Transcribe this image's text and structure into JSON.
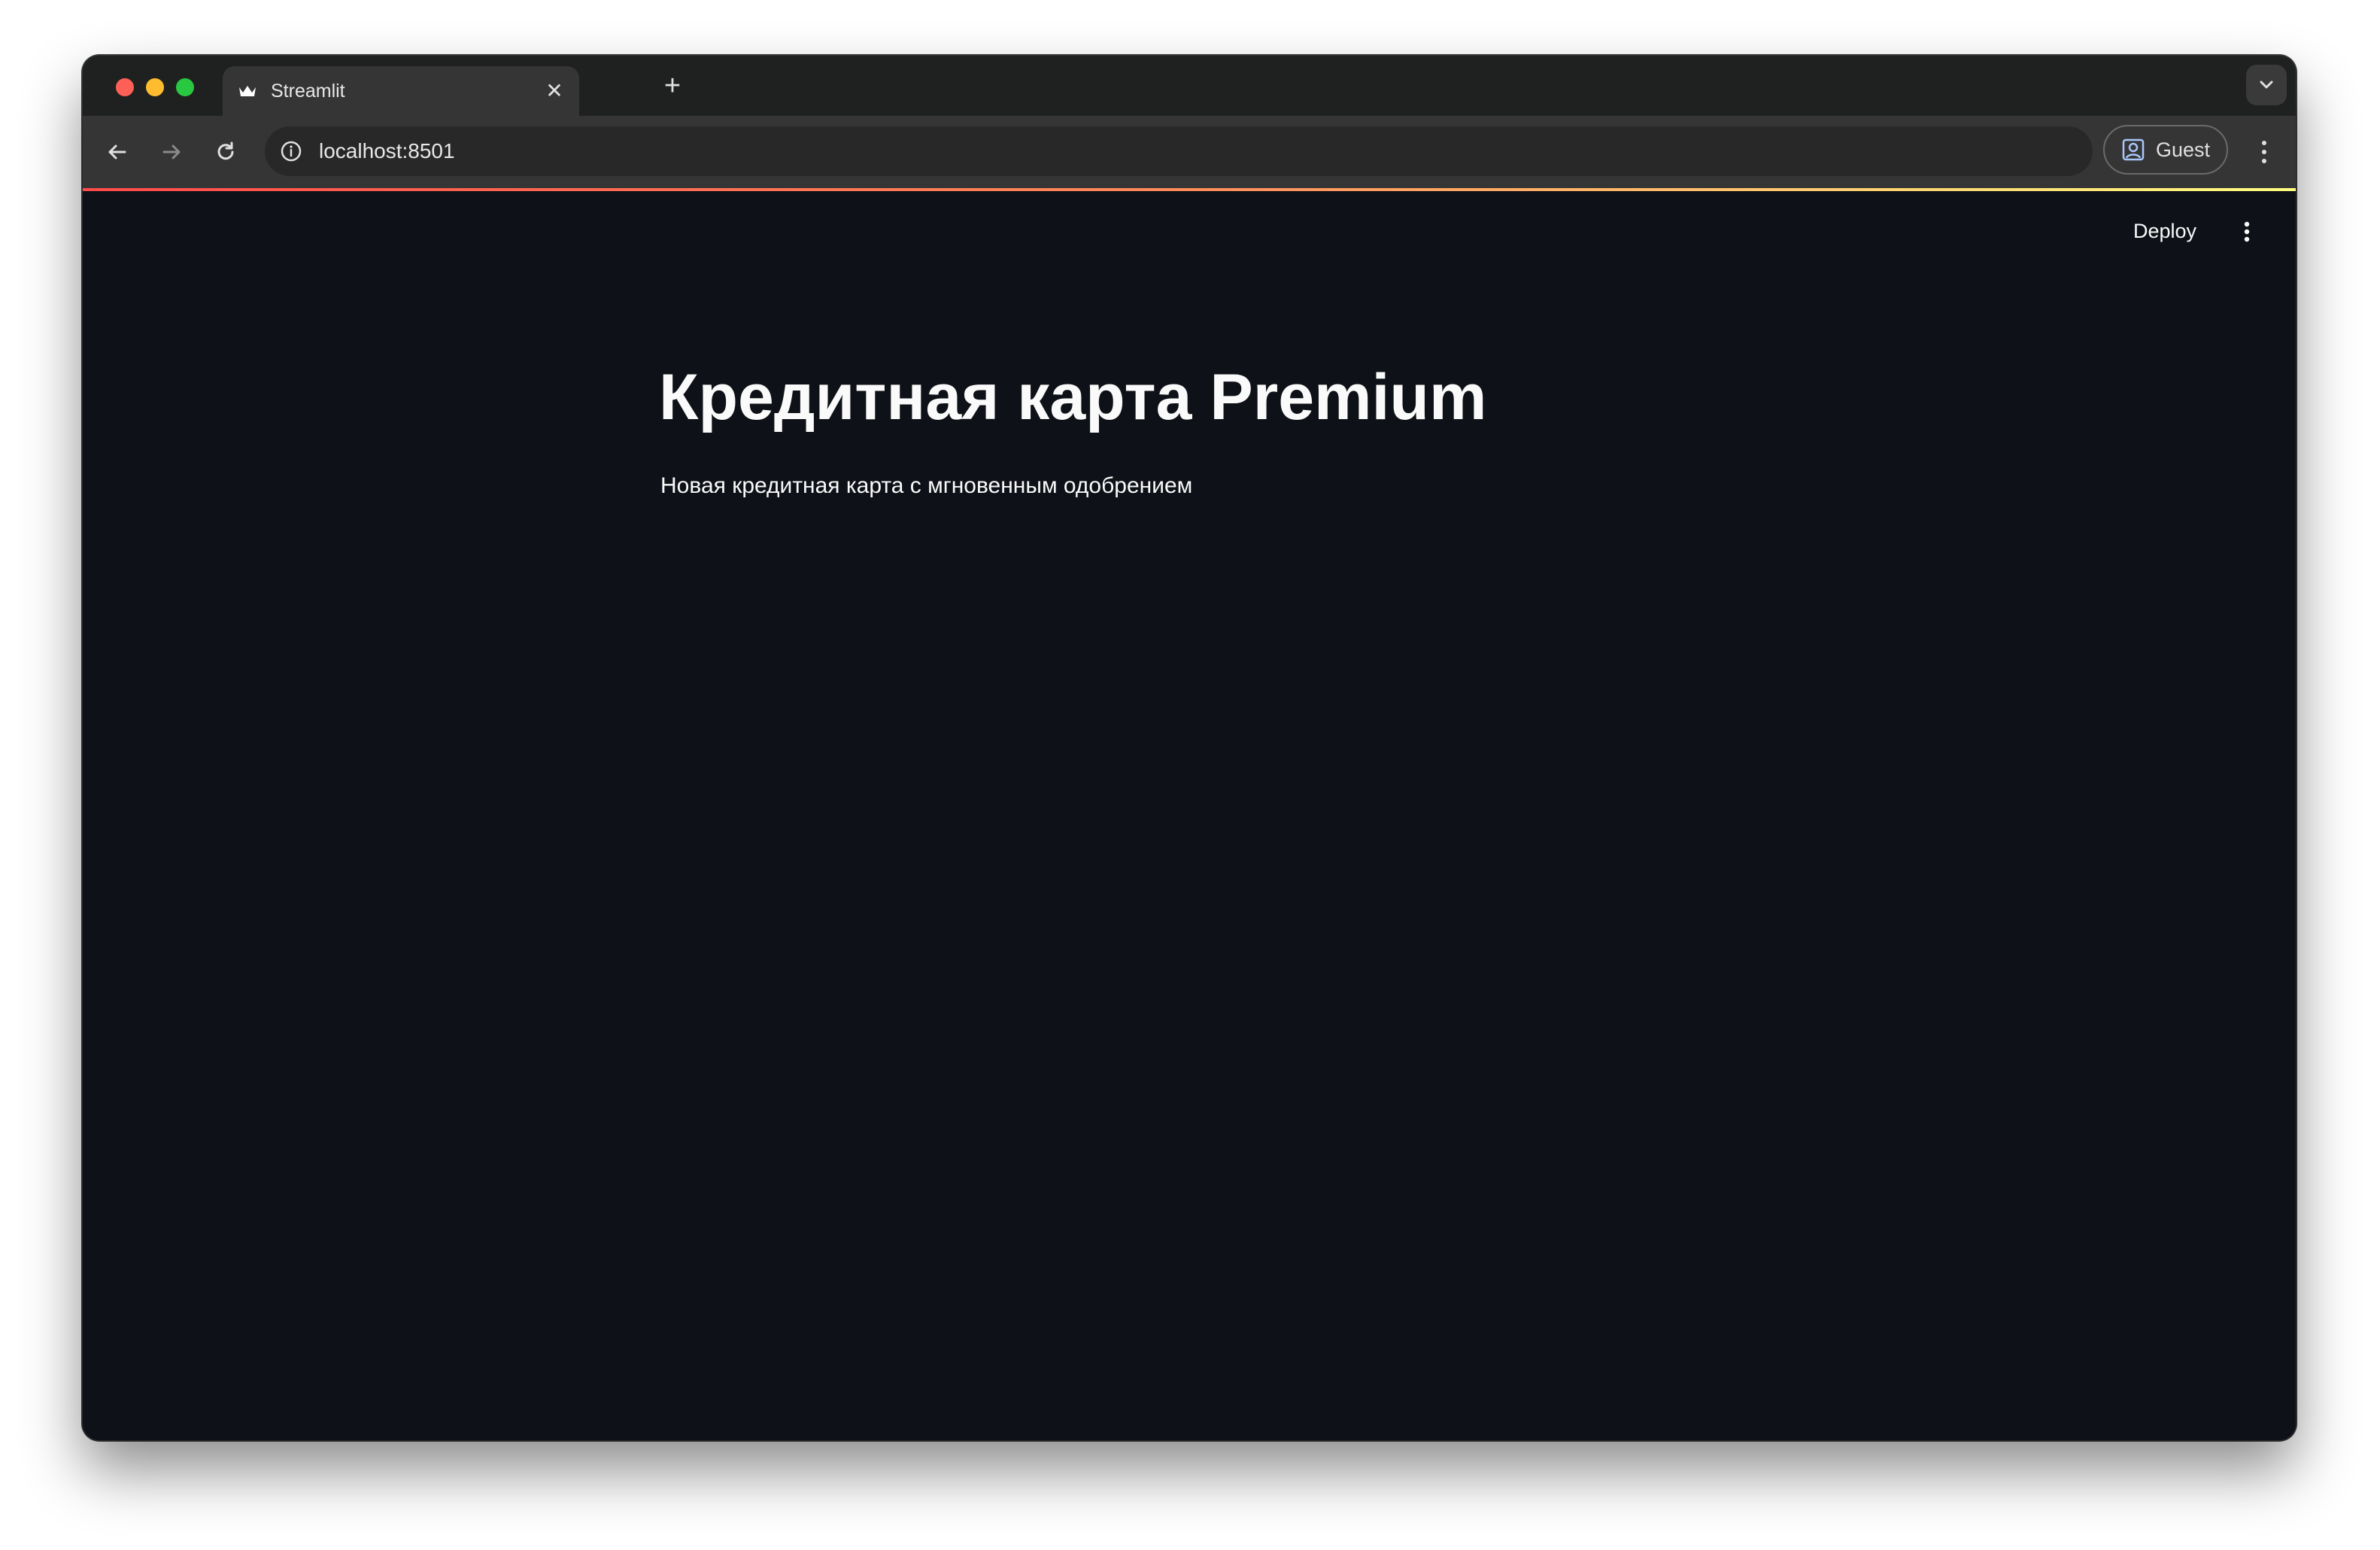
{
  "browser": {
    "tab": {
      "title": "Streamlit",
      "favicon": "streamlit-crown-icon"
    },
    "address_bar": {
      "url": "localhost:8501"
    },
    "profile": {
      "label": "Guest"
    }
  },
  "app": {
    "header": {
      "deploy_label": "Deploy"
    },
    "main": {
      "title": "Кредитная карта Premium",
      "subtitle": "Новая кредитная карта с мгновенным одобрением"
    }
  },
  "colors": {
    "app_background": "#0e1117",
    "text": "#fafafa",
    "decoration_gradient_start": "#ff4b4b",
    "decoration_gradient_end": "#fffd80"
  }
}
